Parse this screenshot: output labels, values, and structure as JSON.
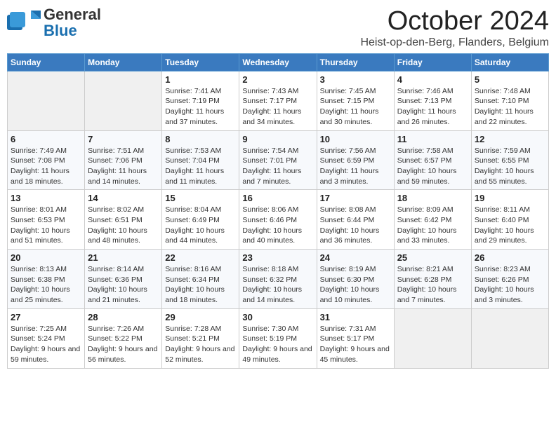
{
  "header": {
    "logo_general": "General",
    "logo_blue": "Blue",
    "month_year": "October 2024",
    "location": "Heist-op-den-Berg, Flanders, Belgium"
  },
  "days_of_week": [
    "Sunday",
    "Monday",
    "Tuesday",
    "Wednesday",
    "Thursday",
    "Friday",
    "Saturday"
  ],
  "weeks": [
    [
      {
        "day": "",
        "sunrise": "",
        "sunset": "",
        "daylight": ""
      },
      {
        "day": "",
        "sunrise": "",
        "sunset": "",
        "daylight": ""
      },
      {
        "day": "1",
        "sunrise": "Sunrise: 7:41 AM",
        "sunset": "Sunset: 7:19 PM",
        "daylight": "Daylight: 11 hours and 37 minutes."
      },
      {
        "day": "2",
        "sunrise": "Sunrise: 7:43 AM",
        "sunset": "Sunset: 7:17 PM",
        "daylight": "Daylight: 11 hours and 34 minutes."
      },
      {
        "day": "3",
        "sunrise": "Sunrise: 7:45 AM",
        "sunset": "Sunset: 7:15 PM",
        "daylight": "Daylight: 11 hours and 30 minutes."
      },
      {
        "day": "4",
        "sunrise": "Sunrise: 7:46 AM",
        "sunset": "Sunset: 7:13 PM",
        "daylight": "Daylight: 11 hours and 26 minutes."
      },
      {
        "day": "5",
        "sunrise": "Sunrise: 7:48 AM",
        "sunset": "Sunset: 7:10 PM",
        "daylight": "Daylight: 11 hours and 22 minutes."
      }
    ],
    [
      {
        "day": "6",
        "sunrise": "Sunrise: 7:49 AM",
        "sunset": "Sunset: 7:08 PM",
        "daylight": "Daylight: 11 hours and 18 minutes."
      },
      {
        "day": "7",
        "sunrise": "Sunrise: 7:51 AM",
        "sunset": "Sunset: 7:06 PM",
        "daylight": "Daylight: 11 hours and 14 minutes."
      },
      {
        "day": "8",
        "sunrise": "Sunrise: 7:53 AM",
        "sunset": "Sunset: 7:04 PM",
        "daylight": "Daylight: 11 hours and 11 minutes."
      },
      {
        "day": "9",
        "sunrise": "Sunrise: 7:54 AM",
        "sunset": "Sunset: 7:01 PM",
        "daylight": "Daylight: 11 hours and 7 minutes."
      },
      {
        "day": "10",
        "sunrise": "Sunrise: 7:56 AM",
        "sunset": "Sunset: 6:59 PM",
        "daylight": "Daylight: 11 hours and 3 minutes."
      },
      {
        "day": "11",
        "sunrise": "Sunrise: 7:58 AM",
        "sunset": "Sunset: 6:57 PM",
        "daylight": "Daylight: 10 hours and 59 minutes."
      },
      {
        "day": "12",
        "sunrise": "Sunrise: 7:59 AM",
        "sunset": "Sunset: 6:55 PM",
        "daylight": "Daylight: 10 hours and 55 minutes."
      }
    ],
    [
      {
        "day": "13",
        "sunrise": "Sunrise: 8:01 AM",
        "sunset": "Sunset: 6:53 PM",
        "daylight": "Daylight: 10 hours and 51 minutes."
      },
      {
        "day": "14",
        "sunrise": "Sunrise: 8:02 AM",
        "sunset": "Sunset: 6:51 PM",
        "daylight": "Daylight: 10 hours and 48 minutes."
      },
      {
        "day": "15",
        "sunrise": "Sunrise: 8:04 AM",
        "sunset": "Sunset: 6:49 PM",
        "daylight": "Daylight: 10 hours and 44 minutes."
      },
      {
        "day": "16",
        "sunrise": "Sunrise: 8:06 AM",
        "sunset": "Sunset: 6:46 PM",
        "daylight": "Daylight: 10 hours and 40 minutes."
      },
      {
        "day": "17",
        "sunrise": "Sunrise: 8:08 AM",
        "sunset": "Sunset: 6:44 PM",
        "daylight": "Daylight: 10 hours and 36 minutes."
      },
      {
        "day": "18",
        "sunrise": "Sunrise: 8:09 AM",
        "sunset": "Sunset: 6:42 PM",
        "daylight": "Daylight: 10 hours and 33 minutes."
      },
      {
        "day": "19",
        "sunrise": "Sunrise: 8:11 AM",
        "sunset": "Sunset: 6:40 PM",
        "daylight": "Daylight: 10 hours and 29 minutes."
      }
    ],
    [
      {
        "day": "20",
        "sunrise": "Sunrise: 8:13 AM",
        "sunset": "Sunset: 6:38 PM",
        "daylight": "Daylight: 10 hours and 25 minutes."
      },
      {
        "day": "21",
        "sunrise": "Sunrise: 8:14 AM",
        "sunset": "Sunset: 6:36 PM",
        "daylight": "Daylight: 10 hours and 21 minutes."
      },
      {
        "day": "22",
        "sunrise": "Sunrise: 8:16 AM",
        "sunset": "Sunset: 6:34 PM",
        "daylight": "Daylight: 10 hours and 18 minutes."
      },
      {
        "day": "23",
        "sunrise": "Sunrise: 8:18 AM",
        "sunset": "Sunset: 6:32 PM",
        "daylight": "Daylight: 10 hours and 14 minutes."
      },
      {
        "day": "24",
        "sunrise": "Sunrise: 8:19 AM",
        "sunset": "Sunset: 6:30 PM",
        "daylight": "Daylight: 10 hours and 10 minutes."
      },
      {
        "day": "25",
        "sunrise": "Sunrise: 8:21 AM",
        "sunset": "Sunset: 6:28 PM",
        "daylight": "Daylight: 10 hours and 7 minutes."
      },
      {
        "day": "26",
        "sunrise": "Sunrise: 8:23 AM",
        "sunset": "Sunset: 6:26 PM",
        "daylight": "Daylight: 10 hours and 3 minutes."
      }
    ],
    [
      {
        "day": "27",
        "sunrise": "Sunrise: 7:25 AM",
        "sunset": "Sunset: 5:24 PM",
        "daylight": "Daylight: 9 hours and 59 minutes."
      },
      {
        "day": "28",
        "sunrise": "Sunrise: 7:26 AM",
        "sunset": "Sunset: 5:22 PM",
        "daylight": "Daylight: 9 hours and 56 minutes."
      },
      {
        "day": "29",
        "sunrise": "Sunrise: 7:28 AM",
        "sunset": "Sunset: 5:21 PM",
        "daylight": "Daylight: 9 hours and 52 minutes."
      },
      {
        "day": "30",
        "sunrise": "Sunrise: 7:30 AM",
        "sunset": "Sunset: 5:19 PM",
        "daylight": "Daylight: 9 hours and 49 minutes."
      },
      {
        "day": "31",
        "sunrise": "Sunrise: 7:31 AM",
        "sunset": "Sunset: 5:17 PM",
        "daylight": "Daylight: 9 hours and 45 minutes."
      },
      {
        "day": "",
        "sunrise": "",
        "sunset": "",
        "daylight": ""
      },
      {
        "day": "",
        "sunrise": "",
        "sunset": "",
        "daylight": ""
      }
    ]
  ]
}
